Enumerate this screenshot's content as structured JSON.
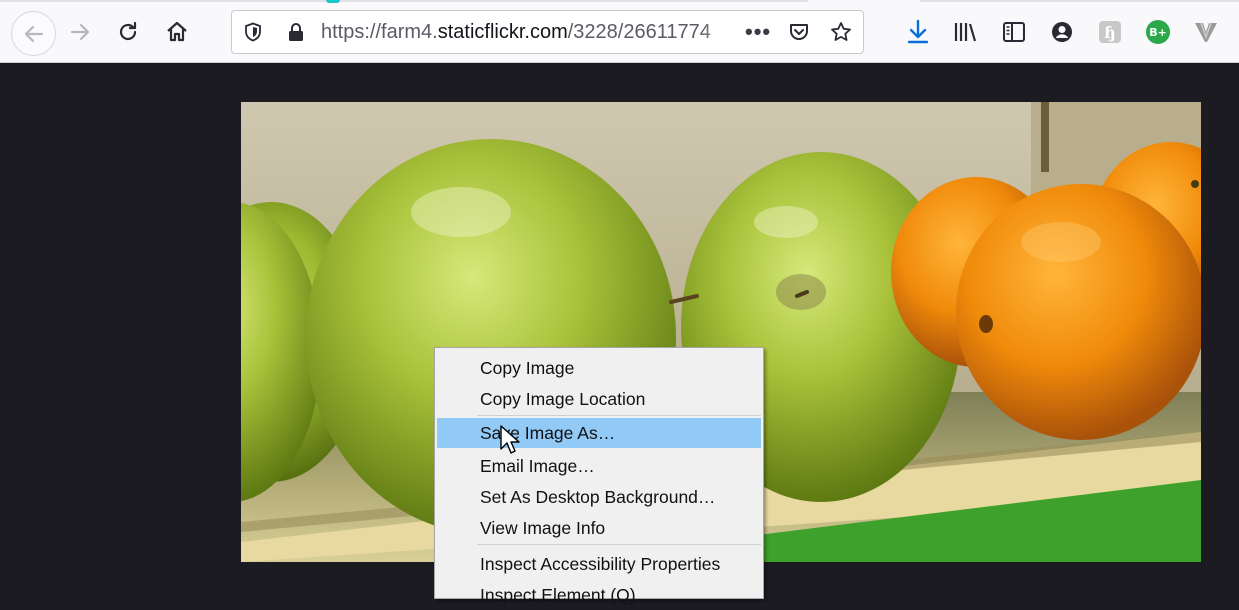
{
  "browser": {
    "url_prefix": "https://farm4.",
    "url_domain": "staticflickr.com",
    "url_suffix": "/3228/26611774",
    "page_actions_icon": "•••"
  },
  "toolbar_icons": {
    "back": "back-arrow-icon",
    "forward": "forward-arrow-icon",
    "reload": "reload-icon",
    "home": "home-icon",
    "tracking": "shield-icon",
    "lock": "lock-icon",
    "pocket": "pocket-icon",
    "bookmark": "star-icon",
    "downloads": "download-icon",
    "library": "library-icon",
    "sidebar": "sidebar-icon",
    "account": "account-icon",
    "ext_h_label": "ɧ",
    "ext_bplus_label": "B+",
    "ext_v": "v-extension-icon"
  },
  "colors": {
    "page_bg": "#1c1b22",
    "menu_highlight": "#91c9f7",
    "download_blue": "#0b6fd8",
    "bplus_green": "#2aa84a"
  },
  "context_menu": {
    "copy_image": "Copy Image",
    "copy_image_location": "Copy Image Location",
    "save_image_as": "Save Image As…",
    "email_image": "Email Image…",
    "set_desktop_background": "Set As Desktop Background…",
    "view_image_info": "View Image Info",
    "inspect_accessibility": "Inspect Accessibility Properties",
    "inspect_element": "Inspect Element (Q)"
  }
}
